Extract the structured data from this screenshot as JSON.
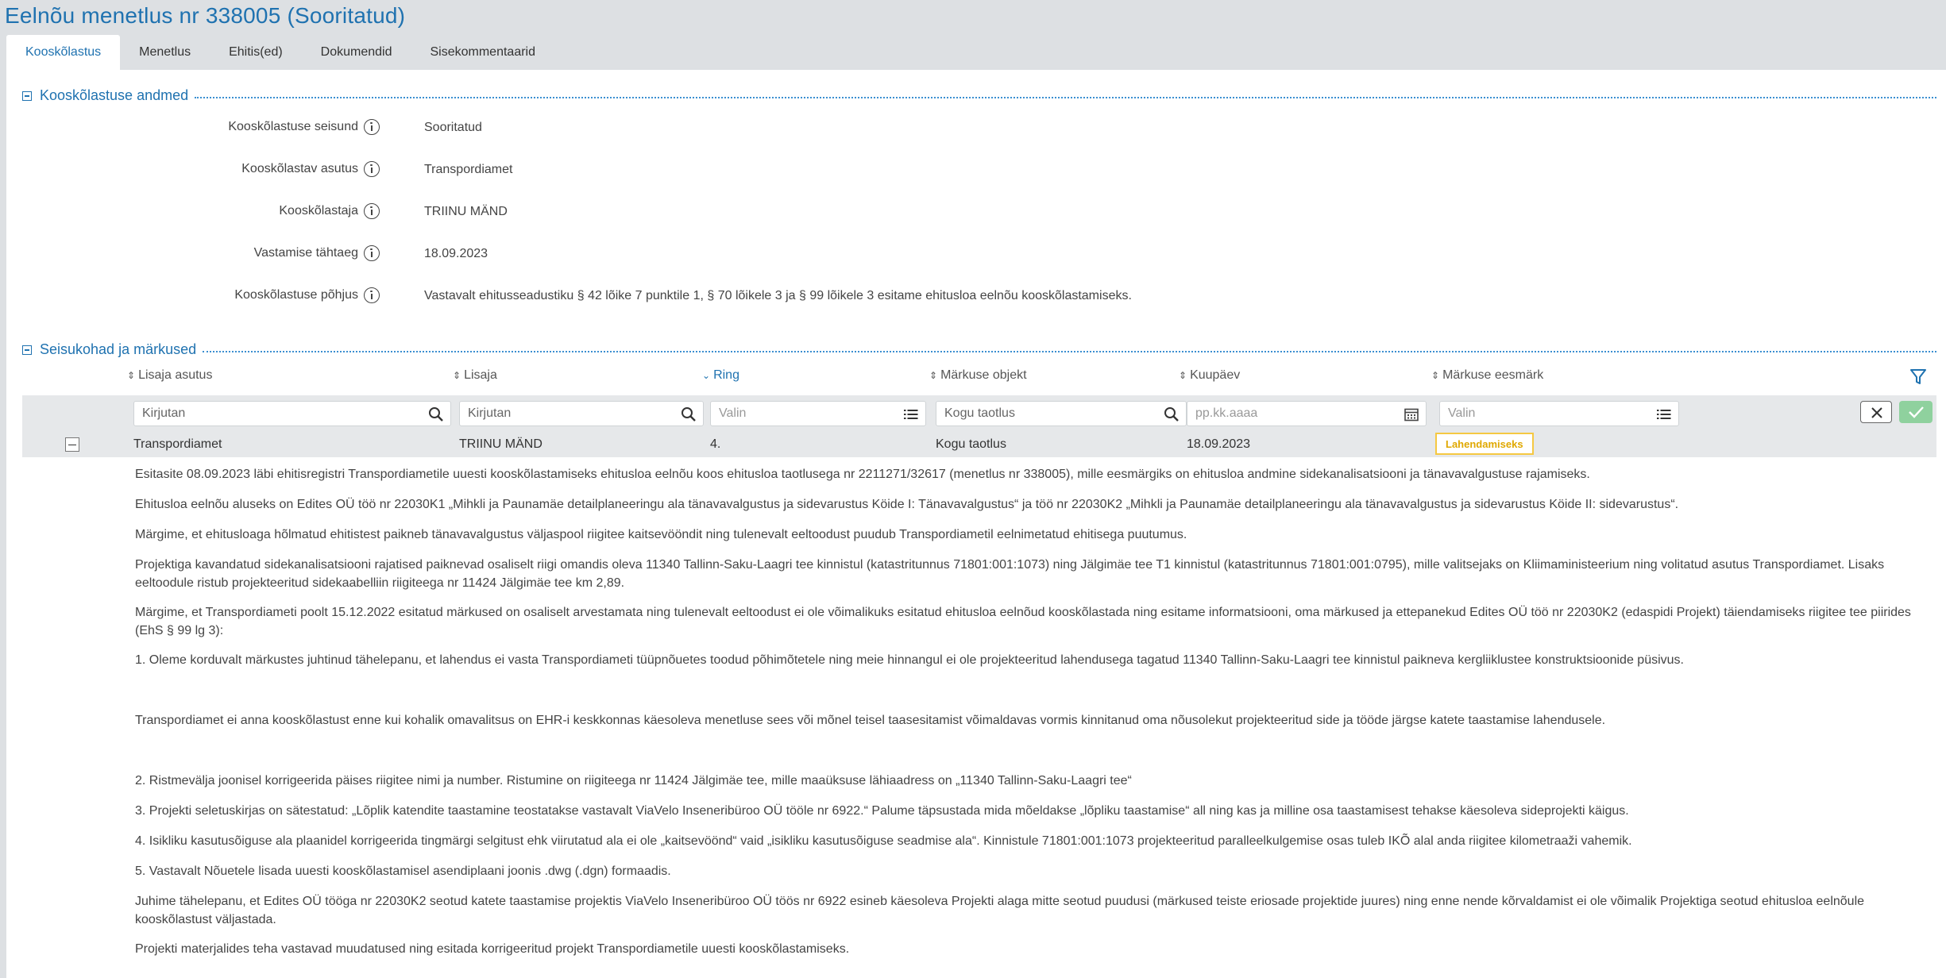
{
  "page": {
    "title": "Eelnõu menetlus nr 338005 (Sooritatud)"
  },
  "tabs": [
    "Kooskõlastus",
    "Menetlus",
    "Ehitis(ed)",
    "Dokumendid",
    "Sisekommentaarid"
  ],
  "section1": {
    "title": "Kooskõlastuse andmed",
    "fields": [
      {
        "label": "Kooskõlastuse seisund",
        "value": "Sooritatud"
      },
      {
        "label": "Kooskõlastav asutus",
        "value": "Transpordiamet"
      },
      {
        "label": "Kooskõlastaja",
        "value": "TRIINU MÄND"
      },
      {
        "label": "Vastamise tähtaeg",
        "value": "18.09.2023"
      },
      {
        "label": "Kooskõlastuse põhjus",
        "value": "Vastavalt ehitusseadustiku § 42 lõike 7 punktile 1, § 70 lõikele 3 ja § 99 lõikele 3 esitame ehitusloa eelnõu kooskõlastamiseks."
      }
    ]
  },
  "section2": {
    "title": "Seisukohad ja märkused",
    "columns": [
      "Lisaja asutus",
      "Lisaja",
      "Ring",
      "Märkuse objekt",
      "Kuupäev",
      "Märkuse eesmärk"
    ],
    "filters": [
      "Kirjutan",
      "Kirjutan",
      "Valin",
      "Kogu taotlus",
      "pp.kk.aaaa",
      "Valin"
    ],
    "row": {
      "asutus": "Transpordiamet",
      "lisaja": "TRIINU MÄND",
      "ring": "4.",
      "objekt": "Kogu taotlus",
      "kuupaev": "18.09.2023",
      "eesmark": "Lahendamiseks"
    },
    "comment": [
      "Esitasite 08.09.2023 läbi ehitisregistri Transpordiametile uuesti kooskõlastamiseks ehitusloa eelnõu koos ehitusloa taotlusega nr 2211271/32617 (menetlus nr 338005), mille eesmärgiks on ehitusloa andmine sidekanalisatsiooni ja tänavavalgustuse rajamiseks.",
      "Ehitusloa eelnõu aluseks on Edites OÜ töö nr 22030K1 „Mihkli ja Paunamäe detailplaneeringu ala tänavavalgustus ja sidevarustus Köide I: Tänavavalgustus“ ja töö nr 22030K2 „Mihkli ja Paunamäe detailplaneeringu ala tänavavalgustus ja sidevarustus Köide II: sidevarustus“.",
      "Märgime, et ehitusloaga hõlmatud ehitistest paikneb tänavavalgustus väljaspool riigitee kaitsevööndit ning tulenevalt eeltoodust puudub Transpordiametil eelnimetatud ehitisega puutumus.",
      "Projektiga kavandatud sidekanalisatsiooni rajatised paiknevad osaliselt riigi omandis oleva 11340 Tallinn-Saku-Laagri tee kinnistul (katastritunnus 71801:001:1073) ning Jälgimäe tee T1 kinnistul (katastritunnus     71801:001:0795), mille valitsejaks on Kliimaministeerium ning volitatud asutus Transpordiamet. Lisaks eeltoodule ristub projekteeritud sidekaabelliin riigiteega nr 11424 Jälgimäe tee km 2,89.",
      "Märgime, et Transpordiameti poolt 15.12.2022 esitatud märkused on osaliselt arvestamata ning tulenevalt eeltoodust ei ole võimalikuks esitatud ehitusloa eelnõud kooskõlastada ning esitame informatsiooni, oma märkused ja ettepanekud Edites OÜ töö nr 22030K2 (edaspidi Projekt) täiendamiseks riigitee tee piirides (EhS § 99 lg 3):",
      "1. Oleme korduvalt märkustes juhtinud tähelepanu, et lahendus ei vasta Transpordiameti tüüpnõuetes toodud põhimõtetele ning meie hinnangul ei ole projekteeritud lahendusega tagatud 11340 Tallinn-Saku-Laagri tee kinnistul paikneva kergliiklustee konstruktsioonide püsivus.",
      "Transpordiamet ei anna kooskõlastust enne kui kohalik omavalitsus on EHR-i keskkonnas käesoleva menetluse sees või mõnel teisel taasesitamist võimaldavas vormis kinnitanud oma nõusolekut projekteeritud side ja tööde järgse katete taastamise lahendusele.",
      "2. Ristmeväljа joonisel korrigeerida päises riigitee nimi ja number. Ristumine on riigiteega nr 11424 Jälgimäe tee, mille maaüksuse lähiaadress on „11340 Tallinn-Saku-Laagri tee“",
      "3. Projekti seletuskirjas on sätestatud: „Lõplik katendite taastamine teostatakse vastavalt ViaVelo Inseneribüroo OÜ tööle nr 6922.“ Palume täpsustada mida mõeldakse „lõpliku taastamise“ all ning kas ja milline osa taastamisest tehakse käesoleva sideprojekti käigus.",
      "4. Isikliku kasutusõiguse ala plaanidel korrigeerida tingmärgi selgitust ehk viirutatud ala ei ole „kaitsevöönd“ vaid „isikliku kasutusõiguse seadmise ala“. Kinnistule 71801:001:1073 projekteeritud paralleelkulgemise osas tuleb IKÕ alal anda riigitee kilometraaži vahemik.",
      "5. Vastavalt Nõuetele lisada uuesti kooskõlastamisel asendiplaani joonis .dwg (.dgn) formaadis.",
      "Juhime tähelepanu, et Edites OÜ tööga nr 22030K2 seotud katete taastamise projektis ViaVelo Inseneribüroo OÜ töös nr 6922 esineb käesoleva Projekti alaga mitte seotud puudusi (märkused teiste eriosade projektide juures) ning enne nende kõrvaldamist ei ole võimalik Projektiga seotud ehitusloa eelnõule kooskõlastust väljastada.",
      "Projekti materjalides teha vastavad muudatused ning esitada korrigeeritud projekt Transpordiametile uuesti kooskõlastamiseks."
    ]
  }
}
